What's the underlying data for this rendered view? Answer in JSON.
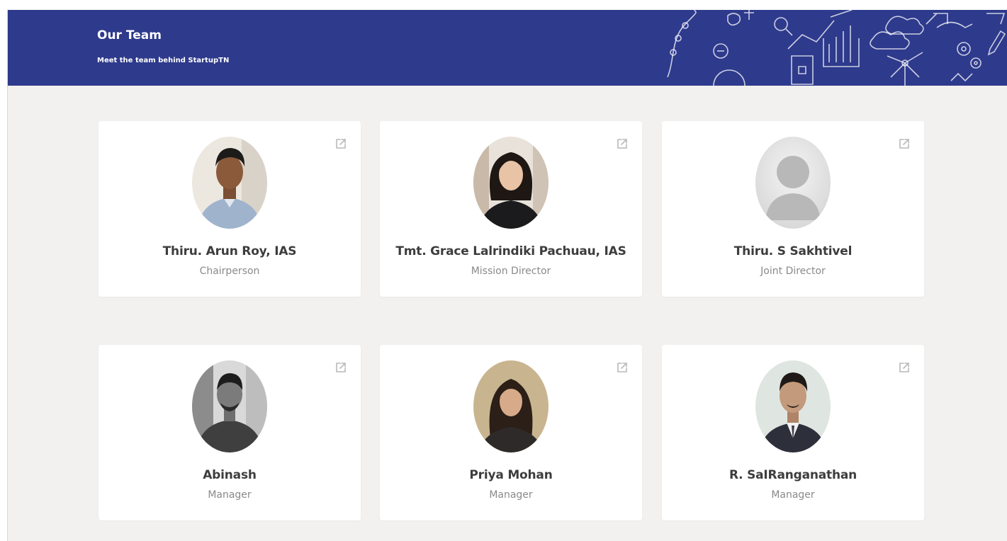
{
  "banner": {
    "title": "Our Team",
    "subtitle": "Meet the team behind StartupTN",
    "background_color": "#2e3a8c"
  },
  "members": [
    {
      "name": "Thiru. Arun Roy, IAS",
      "role": "Chairperson",
      "photo": "photo-young-man-grey-shirt"
    },
    {
      "name": "Tmt. Grace Lalrindiki Pachuau, IAS",
      "role": "Mission Director",
      "photo": "photo-woman-dark-hair"
    },
    {
      "name": "Thiru. S Sakhtivel",
      "role": "Joint Director",
      "photo": "default-avatar-placeholder"
    },
    {
      "name": "Abinash",
      "role": "Manager",
      "photo": "photo-man-black-and-white"
    },
    {
      "name": "Priya Mohan",
      "role": "Manager",
      "photo": "photo-woman-long-hair"
    },
    {
      "name": "R. SaIRanganathan",
      "role": "Manager",
      "photo": "photo-man-suit-moustache"
    }
  ],
  "icons": {
    "external_link": "external-link-icon"
  }
}
